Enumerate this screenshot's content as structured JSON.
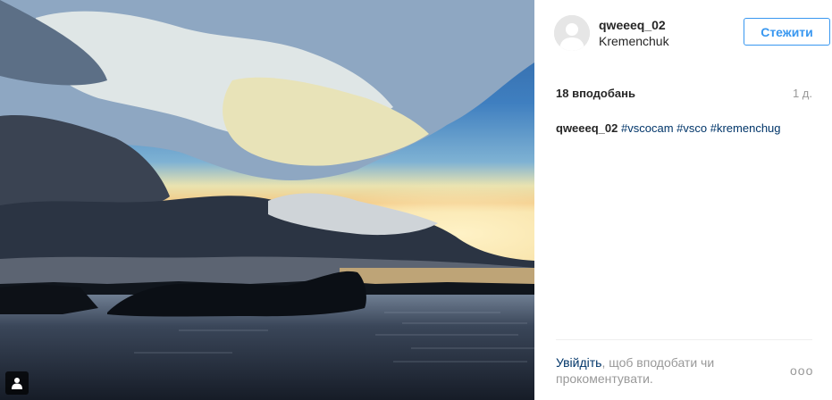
{
  "post": {
    "image_alt": "Sunset over river with dramatic clouds",
    "corner_icon": "person-icon"
  },
  "header": {
    "username": "qweeeq_02",
    "location": "Kremenchuk",
    "follow_label": "Стежити",
    "avatar_icon": "default-avatar-icon"
  },
  "stats": {
    "likes": "18 вподобань",
    "age": "1 д."
  },
  "caption": {
    "author": "qweeeq_02",
    "tags": [
      "#vscocam",
      "#vsco",
      "#kremenchug"
    ]
  },
  "footer": {
    "login_link": "Увійдіть",
    "login_rest": ", щоб вподобати чи прокоментувати.",
    "more_label": "ooo"
  },
  "colors": {
    "accent": "#3897f0",
    "link": "#003569",
    "muted": "#999999"
  }
}
